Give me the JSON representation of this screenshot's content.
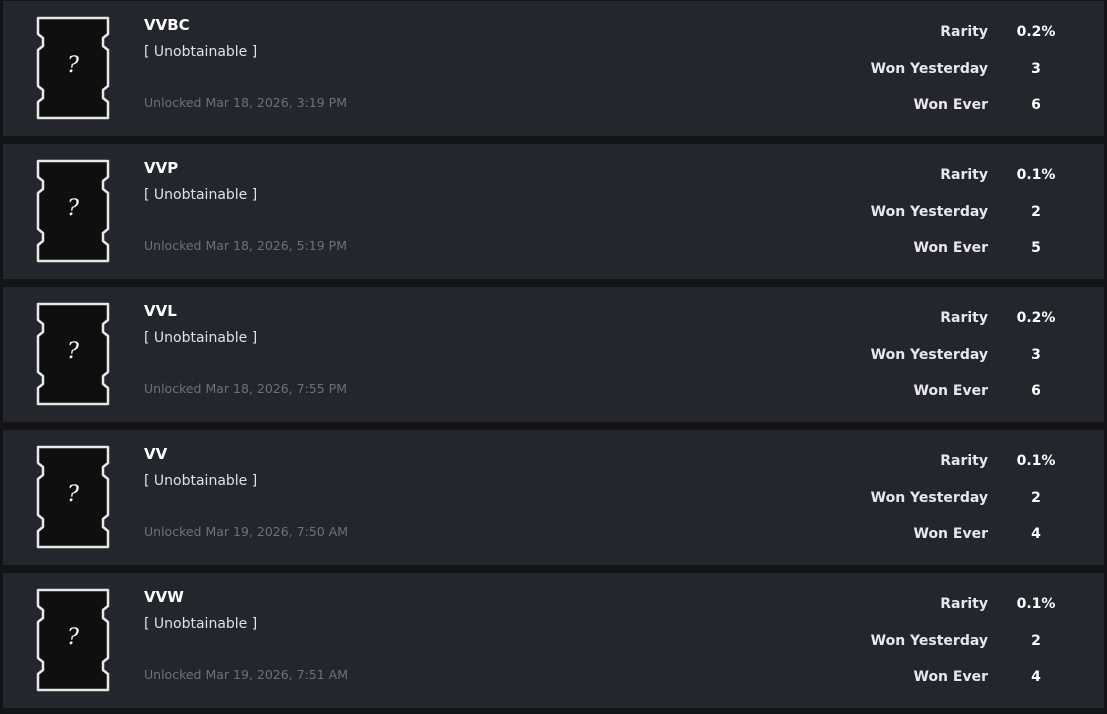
{
  "labels": {
    "rarity": "Rarity",
    "won_yesterday": "Won Yesterday",
    "won_ever": "Won Ever",
    "badge_symbol": "?"
  },
  "achievements": [
    {
      "title": "VVBC",
      "status": "[ Unobtainable ]",
      "unlocked": "Unlocked Mar 18, 2026, 3:19 PM",
      "rarity": "0.2%",
      "won_yesterday": "3",
      "won_ever": "6"
    },
    {
      "title": "VVP",
      "status": "[ Unobtainable ]",
      "unlocked": "Unlocked Mar 18, 2026, 5:19 PM",
      "rarity": "0.1%",
      "won_yesterday": "2",
      "won_ever": "5"
    },
    {
      "title": "VVL",
      "status": "[ Unobtainable ]",
      "unlocked": "Unlocked Mar 18, 2026, 7:55 PM",
      "rarity": "0.2%",
      "won_yesterday": "3",
      "won_ever": "6"
    },
    {
      "title": "VV",
      "status": "[ Unobtainable ]",
      "unlocked": "Unlocked Mar 19, 2026, 7:50 AM",
      "rarity": "0.1%",
      "won_yesterday": "2",
      "won_ever": "4"
    },
    {
      "title": "VVW",
      "status": "[ Unobtainable ]",
      "unlocked": "Unlocked Mar 19, 2026, 7:51 AM",
      "rarity": "0.1%",
      "won_yesterday": "2",
      "won_ever": "4"
    }
  ],
  "colors": {
    "page_background": "#131417",
    "card_background": "#23262c",
    "badge_fill": "#0f0f10",
    "badge_outline": "#e8e8e8",
    "title_text": "#ffffff",
    "muted_text": "#6d7079"
  },
  "icons": {
    "badge": "hidden-achievement-badge-icon"
  }
}
